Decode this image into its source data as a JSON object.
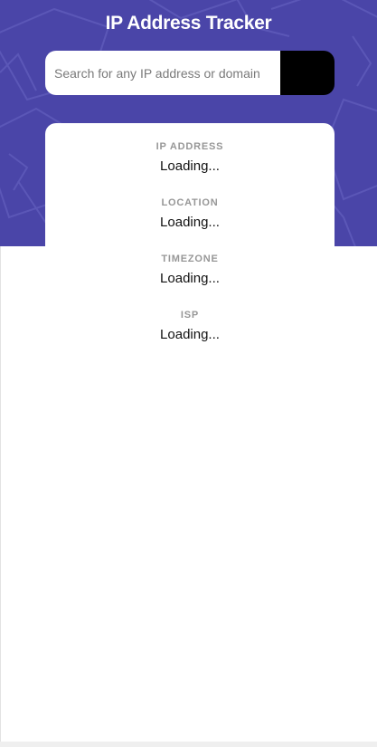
{
  "app": {
    "title": "IP Address Tracker"
  },
  "search": {
    "placeholder": "Search for any IP address or domain",
    "value": "",
    "button_icon": "chevron-right-icon"
  },
  "info": [
    {
      "label": "IP ADDRESS",
      "value": "Loading..."
    },
    {
      "label": "LOCATION",
      "value": "Loading..."
    },
    {
      "label": "TIMEZONE",
      "value": "Loading..."
    },
    {
      "label": "ISP",
      "value": "Loading..."
    }
  ],
  "colors": {
    "header_background": "#4a45a8",
    "button_background": "#000000",
    "label_text": "#979797",
    "value_text": "#111111"
  }
}
